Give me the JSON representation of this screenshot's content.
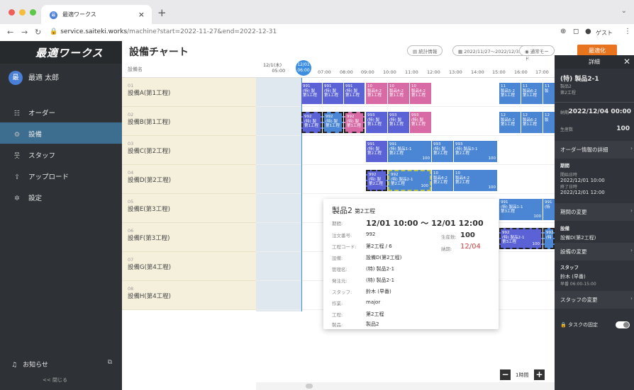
{
  "browser": {
    "tab_title": "最適ワークス",
    "favicon": "最",
    "url_host": "service.saiteki.works",
    "url_path": "/machine?start=2022-11-27&end=2022-12-31",
    "guest_label": "ゲスト"
  },
  "sidebar": {
    "logo": "最適ワークス",
    "user_initial": "最",
    "user_name": "最適 太郎",
    "items": [
      {
        "label": "オーダー"
      },
      {
        "label": "設備"
      },
      {
        "label": "スタッフ"
      },
      {
        "label": "アップロード"
      },
      {
        "label": "設定"
      }
    ],
    "notifications": "お知らせ",
    "close": "<< 閉じる"
  },
  "header": {
    "title": "設備チャート",
    "stats": "統計情報",
    "range": "2022/11/27〜2022/12/31",
    "mode": "通常モード",
    "optimize": "最適化"
  },
  "chart": {
    "column_label": "設備名",
    "day_label": "12/1(木)",
    "day_time": "05:00",
    "today_date": "12/01",
    "today_time": "06:00",
    "hours": [
      "07:00",
      "08:00",
      "09:00",
      "10:00",
      "11:00",
      "12:00",
      "13:00",
      "14:00",
      "15:00",
      "16:00",
      "17:00"
    ],
    "machines": [
      {
        "no": "01",
        "name": "設備A(第1工程)"
      },
      {
        "no": "02",
        "name": "設備B(第1工程)"
      },
      {
        "no": "03",
        "name": "設備C(第2工程)"
      },
      {
        "no": "04",
        "name": "設備D(第2工程)"
      },
      {
        "no": "05",
        "name": "設備E(第3工程)"
      },
      {
        "no": "06",
        "name": "設備F(第3工程)"
      },
      {
        "no": "07",
        "name": "設備G(第4工程)"
      },
      {
        "no": "08",
        "name": "設備H(第4工程)"
      }
    ],
    "zoom_label": "1時間"
  },
  "popup": {
    "product": "製品2",
    "process": "第2工程",
    "period_label": "期間:",
    "period": "12/01 10:00 〜 12/01 12:00",
    "order_no_label": "注文番号:",
    "order_no": "992",
    "code_label": "工程コード:",
    "code": "第2工程 / 6",
    "machine_label": "設備:",
    "machine": "設備D(第2工程)",
    "admin_label": "管理名:",
    "admin": "(特) 製品2-1",
    "origin_label": "発注元:",
    "origin": "(特) 製品2-1",
    "staff_label": "スタッフ:",
    "staff": "鈴木 (早番)",
    "work_label": "作業:",
    "work": "major",
    "step_label": "工程:",
    "step": "第2工程",
    "item_label": "製品:",
    "item": "製品2",
    "qty_label": "生産数:",
    "qty": "100",
    "due_label": "納期:",
    "due": "12/04"
  },
  "detail": {
    "title": "詳細",
    "name": "(特) 製品2-1",
    "sub1": "製品2",
    "sub2": "第2工程",
    "due_label": "納期",
    "due": "2022/12/04 00:00",
    "qty_label": "生産数",
    "qty": "100",
    "order_detail": "オーダー情報の詳細",
    "period_label": "期間",
    "start_label": "開始日時",
    "start": "2022/12/01 10:00",
    "end_label": "終了日時",
    "end": "2022/12/01 12:00",
    "change_period": "期間の変更",
    "machine_label": "設備",
    "machine": "設備D(第2工程)",
    "change_machine": "設備の変更",
    "staff_label": "スタッフ",
    "staff": "鈴木 (早番)",
    "staff_time": "早番 06:00-15:00",
    "change_staff": "スタッフの変更",
    "lock_label": "タスクの固定"
  },
  "colors": {
    "accent": "#3c8fe0",
    "optimize": "#e8741e",
    "sidebar": "#2e3236",
    "bar_purple": "#5a62d6",
    "bar_blue": "#4b86d4",
    "bar_pink": "#d86aa6"
  }
}
